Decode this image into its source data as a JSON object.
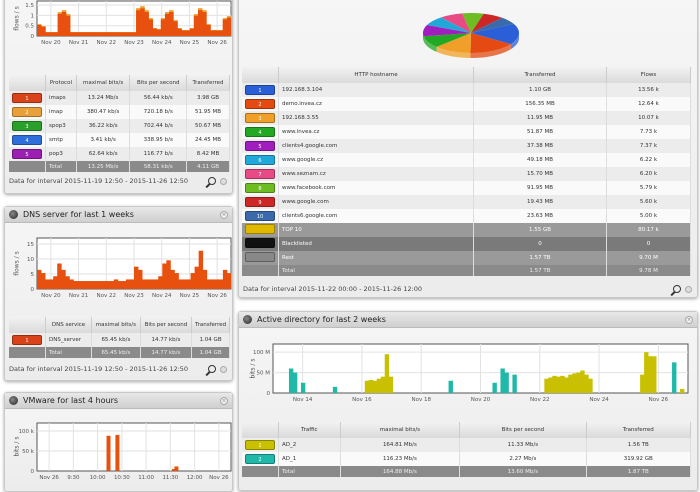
{
  "protocols": {
    "chart": {
      "ylabel": "flows / s",
      "yticks": [
        "0",
        "0.5",
        "1",
        "1.5"
      ],
      "ymax": 1.9,
      "xticks": [
        "Nov 20",
        "Nov 21",
        "Nov 22",
        "Nov 23",
        "Nov 24",
        "Nov 25",
        "Nov 26"
      ],
      "color": "#e8500f",
      "color2": "#f0a030",
      "values": [
        0.6,
        0.5,
        0.2,
        0.2,
        0.2,
        1.2,
        1.3,
        1.1,
        0.2,
        0.2,
        0.2,
        0.2,
        0.2,
        0.2,
        0.2,
        0.2,
        0.2,
        0.2,
        0.2,
        0.2,
        0.2,
        0.2,
        0.2,
        0.2,
        1.4,
        1.5,
        1.3,
        0.9,
        0.4,
        0.35,
        0.9,
        1.2,
        1.3,
        0.8,
        0.4,
        0.3,
        0.3,
        0.4,
        1.1,
        1.4,
        1.3,
        0.6,
        0.3,
        0.3,
        0.3,
        0.9,
        1.0
      ]
    },
    "columns": [
      "",
      "Protocol",
      "maximal bits/s",
      "Bits per second",
      "Transferred"
    ],
    "rows": [
      {
        "n": "1",
        "color": "#d8431a",
        "name": "imaps",
        "max": "13.24 Mb/s",
        "bps": "56.44 kb/s",
        "tr": "3.98 GB"
      },
      {
        "n": "2",
        "color": "#eaa03a",
        "name": "imap",
        "max": "380.47 kb/s",
        "bps": "720.18 b/s",
        "tr": "51.95 MB"
      },
      {
        "n": "3",
        "color": "#2aa02a",
        "name": "spop3",
        "max": "36.22 kb/s",
        "bps": "702.44 b/s",
        "tr": "50.67 MB"
      },
      {
        "n": "4",
        "color": "#2f6fdc",
        "name": "smtp",
        "max": "3.41 kb/s",
        "bps": "338.95 b/s",
        "tr": "24.45 MB"
      },
      {
        "n": "5",
        "color": "#9b1fb0",
        "name": "pop3",
        "max": "62.64 kb/s",
        "bps": "116.77 b/s",
        "tr": "8.42 MB"
      }
    ],
    "total": {
      "label": "Total",
      "max": "13.25 Mb/s",
      "bps": "58.31 kb/s",
      "tr": "4.11 GB"
    },
    "footer": "Data for interval 2015-11-19 12:50 - 2015-11-26 12:50"
  },
  "dns": {
    "title": "DNS server for last 1 weeks",
    "chart": {
      "ylabel": "flows / s",
      "yticks": [
        "0",
        "5",
        "10",
        "15"
      ],
      "ymax": 16,
      "xticks": [
        "Nov 20",
        "Nov 21",
        "Nov 22",
        "Nov 23",
        "Nov 24",
        "Nov 25",
        "Nov 26"
      ],
      "color": "#e8500f",
      "values": [
        6,
        5,
        3,
        3,
        4,
        8,
        6,
        4,
        3,
        2.5,
        2.5,
        2.5,
        2.5,
        2.5,
        2.5,
        2.5,
        2.5,
        2.5,
        2.5,
        3,
        2.5,
        2.5,
        3,
        3,
        7,
        6,
        3,
        3,
        3,
        3,
        4,
        8,
        9,
        6,
        5,
        3,
        3,
        3,
        5,
        7,
        12,
        6,
        3,
        3,
        3,
        3,
        6,
        5
      ]
    },
    "columns": [
      "",
      "DNS service",
      "maximal bits/s",
      "Bits per second",
      "Transferred"
    ],
    "rows": [
      {
        "n": "1",
        "color": "#d8431a",
        "name": "DNS_server",
        "max": "65.45 kb/s",
        "bps": "14.77 kb/s",
        "tr": "1.04 GB"
      }
    ],
    "total": {
      "label": "Total",
      "max": "65.45 kb/s",
      "bps": "14.77 kb/s",
      "tr": "1.04 GB"
    },
    "footer": "Data for interval 2015-11-19 12:50 - 2015-11-26 12:50"
  },
  "vmware": {
    "title": "VMware for last 4 hours",
    "chart": {
      "ylabel": "bits / s",
      "yticks": [
        "0",
        "50 k",
        "100 k"
      ],
      "ymax": 110000,
      "xticks": [
        "Nov 26",
        "9:30",
        "10:00",
        "10:30",
        "11:00",
        "11:30",
        "12:00",
        "Nov 26"
      ],
      "color": "#e8500f",
      "bars": [
        {
          "t": "10:23",
          "v": 85000
        },
        {
          "t": "10:34",
          "v": 87000
        },
        {
          "t": "11:44",
          "v": 5000
        },
        {
          "t": "11:47",
          "v": 11000
        }
      ]
    }
  },
  "http": {
    "pie_values": [
      13.56,
      12.64,
      10.07,
      7.73,
      7.37,
      6.22,
      6.2,
      5.79,
      5.6,
      5.0
    ],
    "columns": [
      "",
      "HTTP hostname",
      "Transferred",
      "Flows"
    ],
    "rows": [
      {
        "n": "1",
        "color": "#2a5fd8",
        "name": "192.168.3.104",
        "tr": "1.10 GB",
        "fl": "13.56 k"
      },
      {
        "n": "2",
        "color": "#e44a12",
        "name": "demo.invea.cz",
        "tr": "156.35 MB",
        "fl": "12.64 k"
      },
      {
        "n": "3",
        "color": "#f0a028",
        "name": "192.168.3.55",
        "tr": "11.95 MB",
        "fl": "10.07 k"
      },
      {
        "n": "4",
        "color": "#22a822",
        "name": "www.invea.cz",
        "tr": "51.87 MB",
        "fl": "7.73 k"
      },
      {
        "n": "5",
        "color": "#a01ebe",
        "name": "clients4.google.com",
        "tr": "37.38 MB",
        "fl": "7.37 k"
      },
      {
        "n": "6",
        "color": "#22a8d8",
        "name": "www.google.cz",
        "tr": "49.18 MB",
        "fl": "6.22 k"
      },
      {
        "n": "7",
        "color": "#e84a86",
        "name": "www.seznam.cz",
        "tr": "15.70 MB",
        "fl": "6.20 k"
      },
      {
        "n": "8",
        "color": "#6cbc22",
        "name": "www.facebook.com",
        "tr": "91.95 MB",
        "fl": "5.79 k"
      },
      {
        "n": "9",
        "color": "#cc2626",
        "name": "www.google.com",
        "tr": "19.43 MB",
        "fl": "5.60 k"
      },
      {
        "n": "10",
        "color": "#3a6aaa",
        "name": "clients6.google.com",
        "tr": "23.63 MB",
        "fl": "5.00 k"
      }
    ],
    "groups": [
      {
        "color": "#e0b800",
        "name": "TOP 10",
        "tr": "1.55 GB",
        "fl": "80.17 k",
        "cls": "g"
      },
      {
        "color": "#111111",
        "name": "Blacklisted",
        "tr": "0",
        "fl": "0",
        "cls": "g2"
      },
      {
        "color": "#888888",
        "name": "Rest",
        "tr": "1.57 TB",
        "fl": "9.70 M",
        "cls": "g"
      }
    ],
    "total": {
      "label": "Total",
      "tr": "1.57 TB",
      "fl": "9.78 M"
    },
    "footer": "Data for interval 2015-11-22 00:00 - 2015-11-26 12:00"
  },
  "ad": {
    "title": "Active directory for last 2 weeks",
    "chart": {
      "ylabel": "bits / s",
      "yticks": [
        "0",
        "50 M",
        "100 M"
      ],
      "ymax": 120,
      "xticks": [
        "Nov 14",
        "Nov 16",
        "Nov 18",
        "Nov 20",
        "Nov 22",
        "Nov 24",
        "Nov 26"
      ],
      "series": [
        {
          "color": "#c8c000",
          "values": [
            0,
            0,
            0,
            0,
            0,
            0,
            0,
            0,
            0,
            0,
            0,
            0,
            0,
            0,
            0,
            0,
            0,
            0,
            0,
            0,
            0,
            0,
            0,
            30,
            32,
            30,
            35,
            40,
            95,
            40,
            0,
            0,
            0,
            0,
            0,
            0,
            0,
            0,
            0,
            0,
            0,
            0,
            0,
            0,
            0,
            0,
            0,
            0,
            0,
            0,
            0,
            0,
            0,
            0,
            0,
            0,
            0,
            0,
            0,
            0,
            0,
            0,
            0,
            0,
            0,
            0,
            0,
            0,
            35,
            38,
            42,
            40,
            42,
            38,
            45,
            48,
            50,
            55,
            45,
            35,
            0,
            0,
            0,
            0,
            0,
            0,
            0,
            0,
            0,
            0,
            0,
            0,
            45,
            100,
            90,
            90,
            0,
            0,
            0,
            0,
            0,
            0,
            10,
            0
          ]
        },
        {
          "color": "#20b8a8",
          "values": [
            0,
            0,
            0,
            0,
            60,
            50,
            0,
            25,
            0,
            0,
            0,
            0,
            0,
            0,
            0,
            15,
            0,
            0,
            0,
            0,
            0,
            0,
            0,
            0,
            0,
            0,
            0,
            0,
            0,
            0,
            0,
            0,
            0,
            0,
            0,
            0,
            0,
            0,
            0,
            0,
            0,
            0,
            0,
            0,
            30,
            0,
            0,
            0,
            0,
            0,
            0,
            0,
            0,
            0,
            0,
            25,
            0,
            60,
            50,
            0,
            45,
            0,
            0,
            0,
            0,
            0,
            0,
            0,
            0,
            0,
            0,
            0,
            0,
            0,
            0,
            0,
            0,
            0,
            0,
            0,
            0,
            0,
            0,
            0,
            0,
            0,
            0,
            0,
            0,
            0,
            0,
            0,
            0,
            0,
            0,
            0,
            0,
            0,
            0,
            0,
            75,
            0,
            0,
            0
          ]
        }
      ]
    },
    "columns": [
      "",
      "Traffic",
      "maximal bits/s",
      "Bits per second",
      "Transferred"
    ],
    "rows": [
      {
        "n": "1",
        "color": "#c8c000",
        "name": "AD_2",
        "max": "164.81 Mb/s",
        "bps": "11.33 Mb/s",
        "tr": "1.56 TB"
      },
      {
        "n": "2",
        "color": "#20b8a8",
        "name": "AD_1",
        "max": "116.23 Mb/s",
        "bps": "2.27 Mb/s",
        "tr": "319.92 GB"
      }
    ],
    "total": {
      "label": "Total",
      "max": "164.88 Mb/s",
      "bps": "13.60 Mb/s",
      "tr": "1.87 TB"
    }
  }
}
